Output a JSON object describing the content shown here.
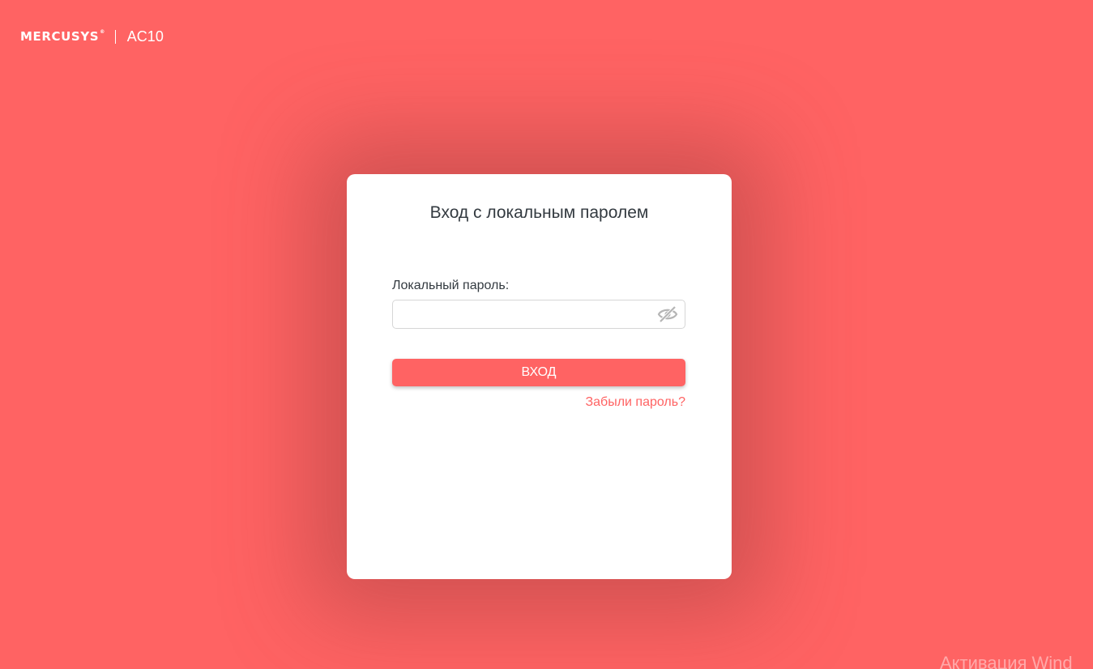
{
  "header": {
    "brand": "MERCUSYS",
    "brand_mark": "®",
    "model": "AC10"
  },
  "login": {
    "title": "Вход с локальным паролем",
    "password_label": "Локальный пароль:",
    "password_value": "",
    "eye_icon": "eye-slash-icon",
    "submit_label": "ВХОД",
    "forgot_label": "Забыли пароль?"
  },
  "system": {
    "watermark": "Активация Wind"
  },
  "colors": {
    "background": "#ff6363",
    "accent": "#ff6363",
    "card": "#ffffff",
    "text": "#333a40"
  }
}
